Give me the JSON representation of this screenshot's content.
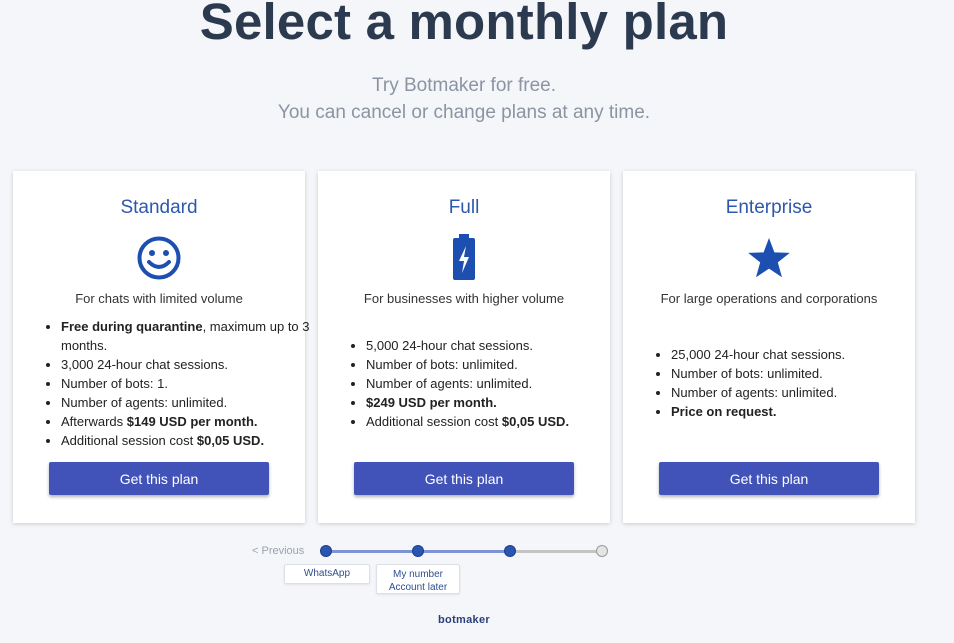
{
  "header": {
    "title": "Select a monthly plan",
    "subtitle_line1": "Try Botmaker for free.",
    "subtitle_line2": "You can cancel or change plans at any time."
  },
  "plans": [
    {
      "name": "Standard",
      "icon": "smiley-face-icon",
      "description": "For chats with limited volume",
      "features": [
        {
          "bold": "Free during quarantine",
          "text": ", maximum up to 3 months."
        },
        {
          "bold": "",
          "text": "3,000 24-hour chat sessions."
        },
        {
          "bold": "",
          "text": "Number of bots: 1."
        },
        {
          "bold": "",
          "text": "Number of agents: unlimited."
        },
        {
          "prefix": "Afterwards ",
          "bold": "$149 USD per month.",
          "text": ""
        },
        {
          "prefix": "Additional session cost ",
          "bold": "$0,05 USD.",
          "text": ""
        }
      ],
      "button_label": "Get this plan"
    },
    {
      "name": "Full",
      "icon": "battery-charging-icon",
      "description": "For businesses with higher volume",
      "features": [
        {
          "bold": "",
          "text": "5,000 24-hour chat sessions."
        },
        {
          "bold": "",
          "text": "Number of bots: unlimited."
        },
        {
          "bold": "",
          "text": "Number of agents: unlimited."
        },
        {
          "bold": "$249 USD per month.",
          "text": ""
        },
        {
          "prefix": "Additional session cost ",
          "bold": "$0,05 USD.",
          "text": ""
        }
      ],
      "button_label": "Get this plan"
    },
    {
      "name": "Enterprise",
      "icon": "star-icon",
      "description": "For large operations and corporations",
      "features": [
        {
          "bold": "",
          "text": "25,000 24-hour chat sessions."
        },
        {
          "bold": "",
          "text": "Number of bots: unlimited."
        },
        {
          "bold": "",
          "text": "Number of agents: unlimited."
        },
        {
          "bold": "Price on request.",
          "text": ""
        }
      ],
      "button_label": "Get this plan"
    }
  ],
  "stepper": {
    "previous_label": "< Previous",
    "steps": [
      {
        "state": "completed"
      },
      {
        "state": "completed"
      },
      {
        "state": "current"
      },
      {
        "state": "pending"
      }
    ],
    "tag1": "WhatsApp",
    "tag2_line1": "My number",
    "tag2_line2": "Account later"
  },
  "footer": {
    "logo_text": "botmaker"
  },
  "colors": {
    "accent": "#4153b8",
    "title": "#2c3a4f",
    "plan_name": "#2e58ad",
    "icon": "#1c4fb0"
  }
}
